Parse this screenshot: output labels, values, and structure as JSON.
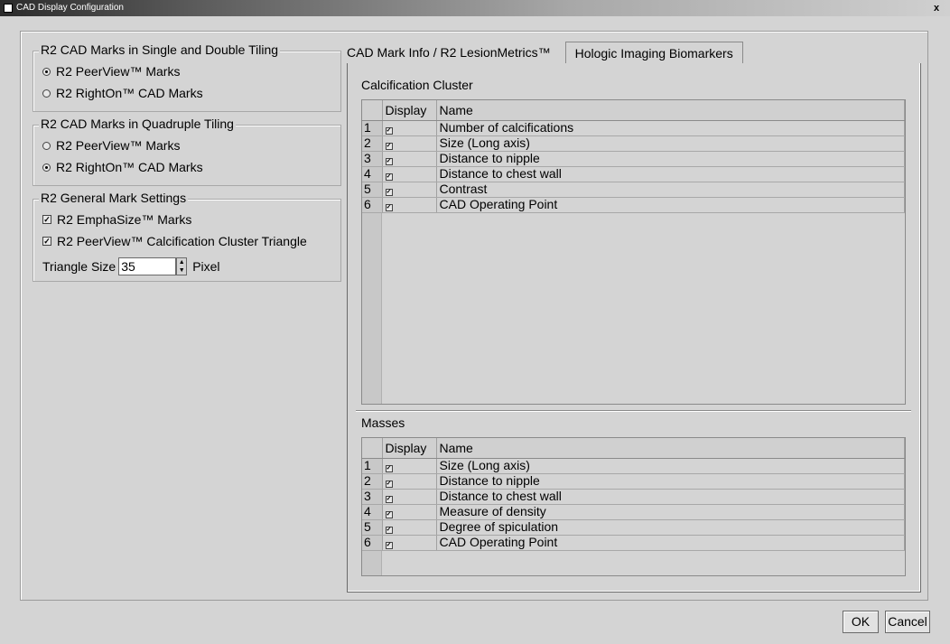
{
  "window": {
    "title": "CAD Display Configuration",
    "close_label": "x"
  },
  "single_double": {
    "legend": "R2 CAD Marks in Single and Double Tiling",
    "options": [
      {
        "label": "R2 PeerView™ Marks",
        "selected": true
      },
      {
        "label": "R2 RightOn™ CAD Marks",
        "selected": false
      }
    ]
  },
  "quadruple": {
    "legend": "R2 CAD Marks in Quadruple Tiling",
    "options": [
      {
        "label": "R2 PeerView™ Marks",
        "selected": false
      },
      {
        "label": "R2 RightOn™ CAD Marks",
        "selected": true
      }
    ]
  },
  "general": {
    "legend": "R2 General Mark Settings",
    "checks": [
      {
        "label": "R2 EmphaSize™ Marks",
        "checked": true
      },
      {
        "label": "R2 PeerView™ Calcification Cluster Triangle",
        "checked": true
      }
    ],
    "triangle_label": "Triangle Size",
    "triangle_value": "35",
    "unit": "Pixel"
  },
  "tabs": [
    {
      "label": "CAD Mark Info / R2 LesionMetrics™",
      "active": true
    },
    {
      "label": "Hologic Imaging Biomarkers",
      "active": false
    }
  ],
  "calcification": {
    "title": "Calcification Cluster",
    "headers": {
      "display": "Display",
      "name": "Name"
    },
    "rows": [
      {
        "num": "1",
        "name": "Number of calcifications",
        "checked": true
      },
      {
        "num": "2",
        "name": "Size (Long axis)",
        "checked": true
      },
      {
        "num": "3",
        "name": "Distance to nipple",
        "checked": true
      },
      {
        "num": "4",
        "name": "Distance to chest wall",
        "checked": true
      },
      {
        "num": "5",
        "name": "Contrast",
        "checked": true
      },
      {
        "num": "6",
        "name": "CAD Operating Point",
        "checked": true
      }
    ]
  },
  "masses": {
    "title": "Masses",
    "headers": {
      "display": "Display",
      "name": "Name"
    },
    "rows": [
      {
        "num": "1",
        "name": "Size (Long axis)",
        "checked": true
      },
      {
        "num": "2",
        "name": "Distance to nipple",
        "checked": true
      },
      {
        "num": "3",
        "name": "Distance to chest wall",
        "checked": true
      },
      {
        "num": "4",
        "name": "Measure of density",
        "checked": true
      },
      {
        "num": "5",
        "name": "Degree of spiculation",
        "checked": true
      },
      {
        "num": "6",
        "name": "CAD Operating Point",
        "checked": true
      }
    ]
  },
  "buttons": {
    "ok": "OK",
    "cancel": "Cancel"
  }
}
